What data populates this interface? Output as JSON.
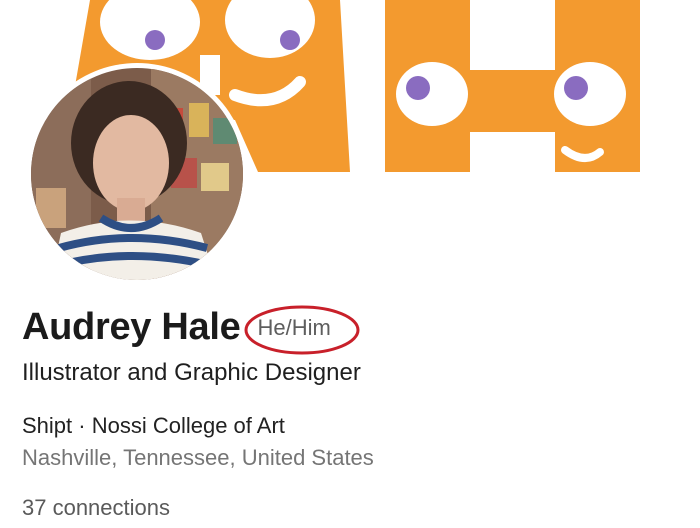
{
  "profile": {
    "name": "Audrey Hale",
    "pronouns": "He/Him",
    "headline": "Illustrator and Graphic Designer",
    "org_line": "Shipt · Nossi College of Art",
    "location": "Nashville, Tennessee, United States",
    "connections": "37 connections"
  },
  "colors": {
    "banner_orange": "#f39a2f",
    "eye_purple": "#8a6cc0",
    "highlight_circle": "#c8202a"
  }
}
